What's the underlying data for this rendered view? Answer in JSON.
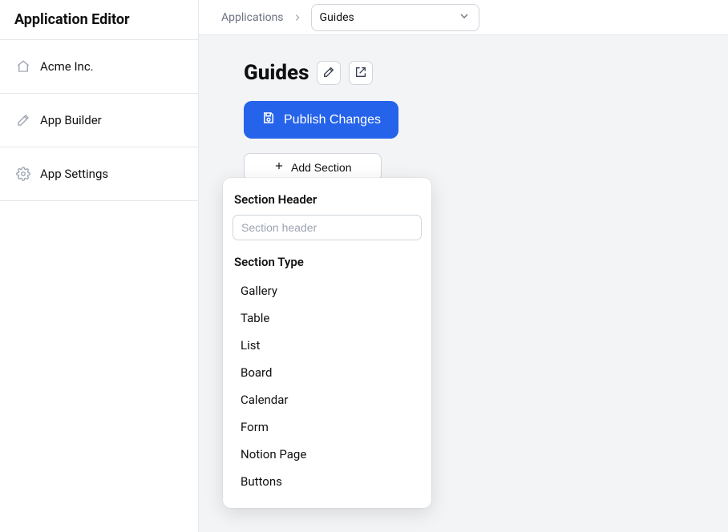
{
  "sidebar": {
    "title": "Application Editor",
    "items": [
      {
        "label": "Acme Inc.",
        "icon": "home"
      },
      {
        "label": "App Builder",
        "icon": "pencil"
      },
      {
        "label": "App Settings",
        "icon": "gear"
      }
    ]
  },
  "breadcrumb": {
    "root": "Applications",
    "selected": "Guides"
  },
  "page": {
    "title": "Guides",
    "publish_label": "Publish Changes",
    "add_section_label": "Add Section"
  },
  "popover": {
    "header_label": "Section Header",
    "header_placeholder": "Section header",
    "type_label": "Section Type",
    "types": [
      "Gallery",
      "Table",
      "List",
      "Board",
      "Calendar",
      "Form",
      "Notion Page",
      "Buttons"
    ]
  },
  "colors": {
    "primary": "#2563eb"
  }
}
